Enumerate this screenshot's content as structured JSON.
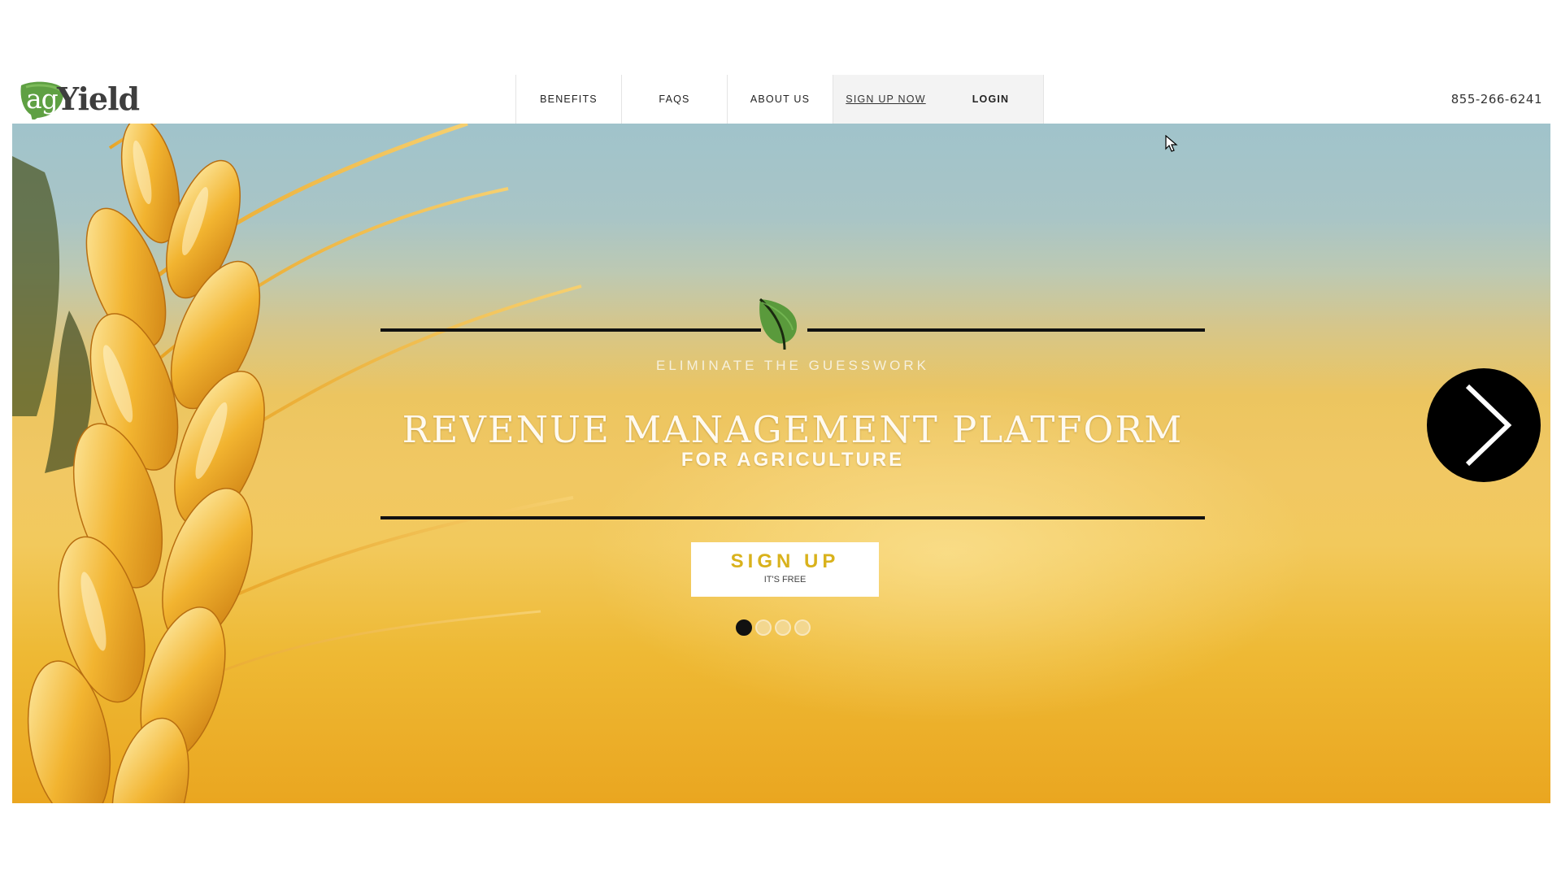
{
  "brand": {
    "logo_ag": "ag",
    "logo_yield": "Yield"
  },
  "nav": {
    "items": [
      {
        "label": "BENEFITS"
      },
      {
        "label": "FAQS"
      },
      {
        "label": "ABOUT US"
      },
      {
        "label": "SIGN UP NOW"
      },
      {
        "label": "LOGIN"
      }
    ]
  },
  "phone": "855-266-6241",
  "hero": {
    "tagline": "ELIMINATE THE GUESSWORK",
    "headline": "REVENUE MANAGEMENT PLATFORM",
    "subheadline": "FOR AGRICULTURE",
    "cta_label": "SIGN UP",
    "cta_sublabel": "IT'S FREE",
    "slides_total": 4,
    "active_slide": 1
  },
  "colors": {
    "leaf_green": "#5a9a3c",
    "cta_text": "#d9b21c",
    "line": "#111111"
  },
  "icons": [
    "leaf-icon",
    "chevron-right-icon",
    "mouse-cursor-icon"
  ]
}
